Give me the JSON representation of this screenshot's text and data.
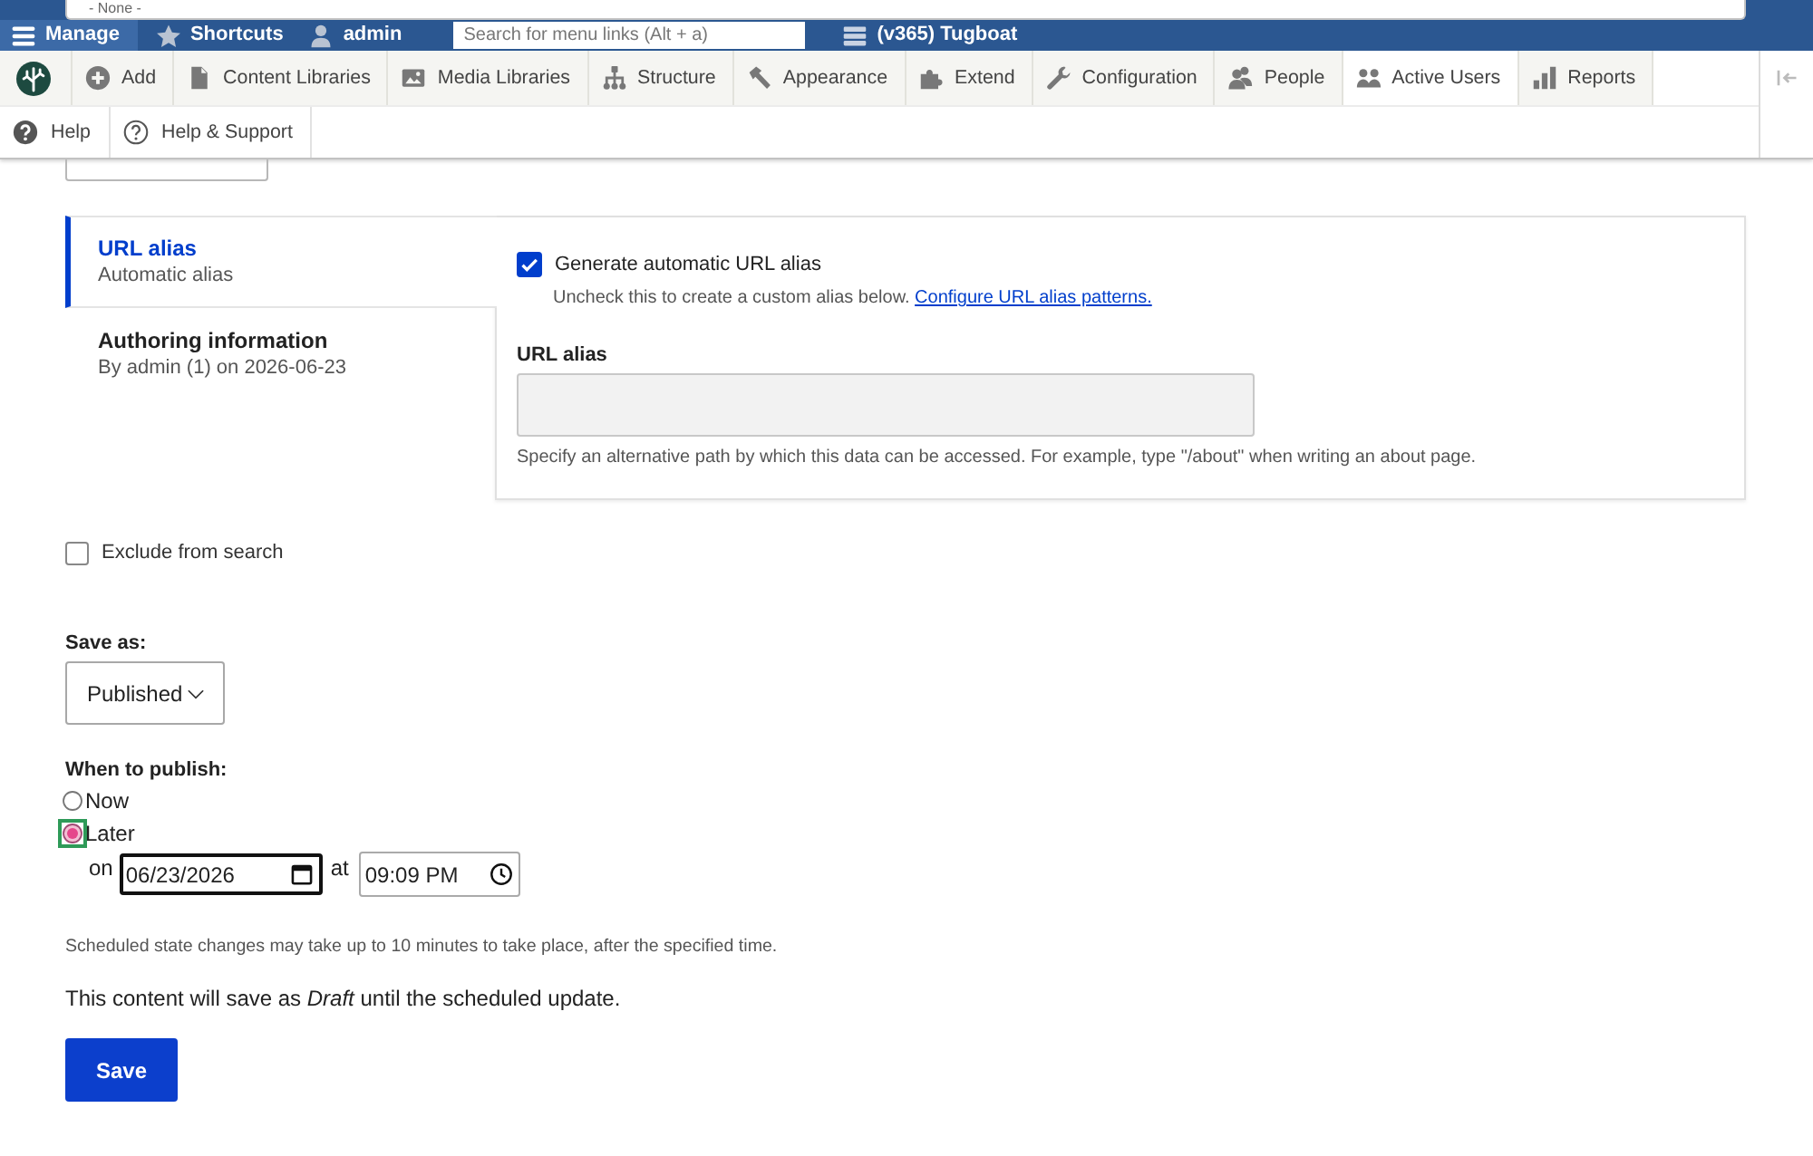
{
  "overlay_select": {
    "value": "- None -"
  },
  "toolbar": {
    "tabs": [
      {
        "label": "Manage",
        "selected": true
      },
      {
        "label": "Shortcuts",
        "selected": false
      },
      {
        "label": "admin",
        "selected": false
      }
    ],
    "search": {
      "placeholder": "Search for menu links (Alt + a)"
    },
    "environment": "(v365) Tugboat"
  },
  "tray": {
    "items": [
      {
        "label": "Add",
        "selected": false
      },
      {
        "label": "Content Libraries",
        "selected": false
      },
      {
        "label": "Media Libraries",
        "selected": false
      },
      {
        "label": "Structure",
        "selected": false
      },
      {
        "label": "Appearance",
        "selected": false
      },
      {
        "label": "Extend",
        "selected": false
      },
      {
        "label": "Configuration",
        "selected": false
      },
      {
        "label": "People",
        "selected": false
      },
      {
        "label": "Active Users",
        "selected": true
      },
      {
        "label": "Reports",
        "selected": false
      }
    ],
    "secondary_items": [
      {
        "label": "Help"
      },
      {
        "label": "Help & Support"
      }
    ]
  },
  "vertical_tabs": {
    "tabs": [
      {
        "title": "URL alias",
        "summary": "Automatic alias",
        "selected": true
      },
      {
        "title": "Authoring information",
        "summary": "By admin (1) on 2026-06-23",
        "selected": false
      }
    ],
    "pane": {
      "checkbox": {
        "label": "Generate automatic URL alias",
        "checked": true
      },
      "description": "Uncheck this to create a custom alias below.",
      "link": "Configure URL alias patterns.",
      "field": {
        "label": "URL alias",
        "disabled": true
      },
      "field_description": "Specify an alternative path by which this data can be accessed. For example, type \"/about\" when writing an about page."
    }
  },
  "exclude_search": {
    "label": "Exclude from search",
    "checked": false
  },
  "save_as": {
    "label": "Save as:",
    "value": "Published"
  },
  "publish": {
    "label": "When to publish:",
    "options": [
      {
        "label": "Now",
        "selected": false,
        "focused": false
      },
      {
        "label": "Later",
        "selected": true,
        "focused": true
      }
    ],
    "schedule": {
      "on_label": "on",
      "date": "06/23/2026",
      "at_label": "at",
      "time": "09:09 PM"
    }
  },
  "note": "Scheduled state changes may take up to 10 minutes to take place, after the specified time.",
  "summary": "This content will save as *Draft* until the scheduled update.",
  "save_button": "Save"
}
